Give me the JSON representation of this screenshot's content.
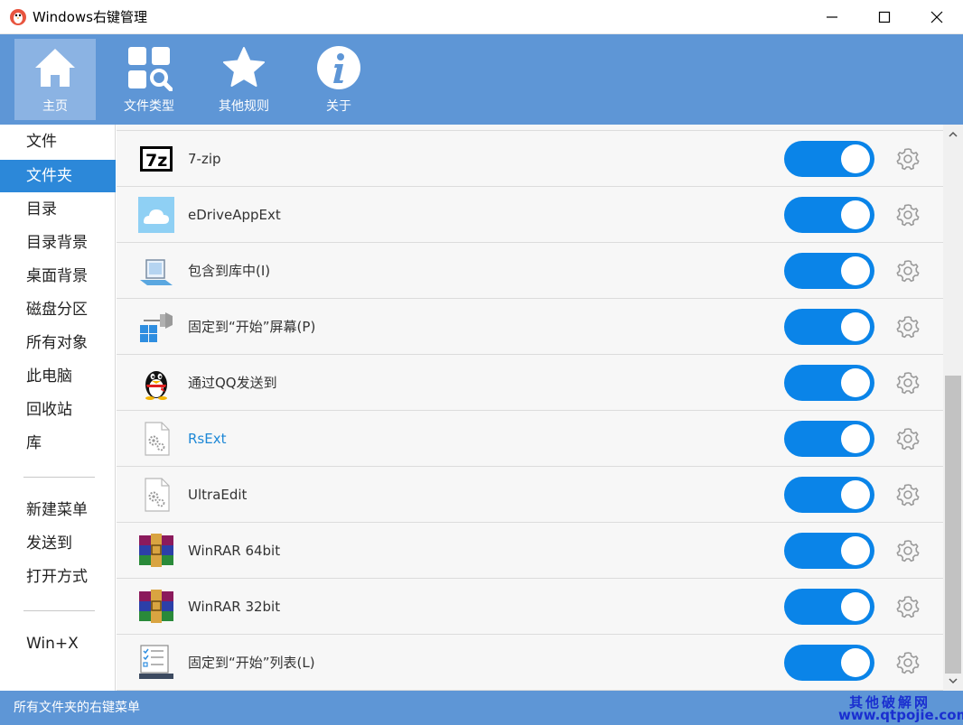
{
  "window": {
    "title": "Windows右键管理"
  },
  "toolbar": {
    "buttons": [
      {
        "label": "主页",
        "icon": "home-icon",
        "active": true
      },
      {
        "label": "文件类型",
        "icon": "file-type-icon",
        "active": false
      },
      {
        "label": "其他规则",
        "icon": "star-icon",
        "active": false
      },
      {
        "label": "关于",
        "icon": "info-icon",
        "active": false
      }
    ]
  },
  "sidebar": {
    "items": [
      {
        "label": "文件"
      },
      {
        "label": "文件夹",
        "active": true
      },
      {
        "label": "目录"
      },
      {
        "label": "目录背景"
      },
      {
        "label": "桌面背景"
      },
      {
        "label": "磁盘分区"
      },
      {
        "label": "所有对象"
      },
      {
        "label": "此电脑"
      },
      {
        "label": "回收站"
      },
      {
        "label": "库"
      },
      {
        "label": "新建菜单"
      },
      {
        "label": "发送到"
      },
      {
        "label": "打开方式"
      },
      {
        "label": "Win+X"
      }
    ]
  },
  "list": {
    "items": [
      {
        "label": "7-zip",
        "icon": "7zip-icon",
        "enabled": true
      },
      {
        "label": "eDriveAppExt",
        "icon": "cloud-icon",
        "enabled": true
      },
      {
        "label": "包含到库中(I)",
        "icon": "library-icon",
        "enabled": true
      },
      {
        "label": "固定到“开始”屏幕(P)",
        "icon": "pin-start-icon",
        "enabled": true
      },
      {
        "label": "通过QQ发送到",
        "icon": "qq-icon",
        "enabled": true
      },
      {
        "label": "RsExt",
        "icon": "gear-file-icon",
        "enabled": true,
        "highlight": true
      },
      {
        "label": "UltraEdit",
        "icon": "gear-file-icon",
        "enabled": true
      },
      {
        "label": "WinRAR 64bit",
        "icon": "winrar-icon",
        "enabled": true
      },
      {
        "label": "WinRAR 32bit",
        "icon": "winrar-icon",
        "enabled": true
      },
      {
        "label": "固定到“开始”列表(L)",
        "icon": "start-list-icon",
        "enabled": true
      }
    ]
  },
  "status": {
    "text": "所有文件夹的右键菜单",
    "watermark_line1": "其他破解网",
    "watermark_line2": "www.qtpojie.com"
  },
  "colors": {
    "accent": "#5e96d6",
    "toggle_on": "#0a84e8",
    "sidebar_active": "#2c88d9",
    "link": "#1e88d6"
  }
}
